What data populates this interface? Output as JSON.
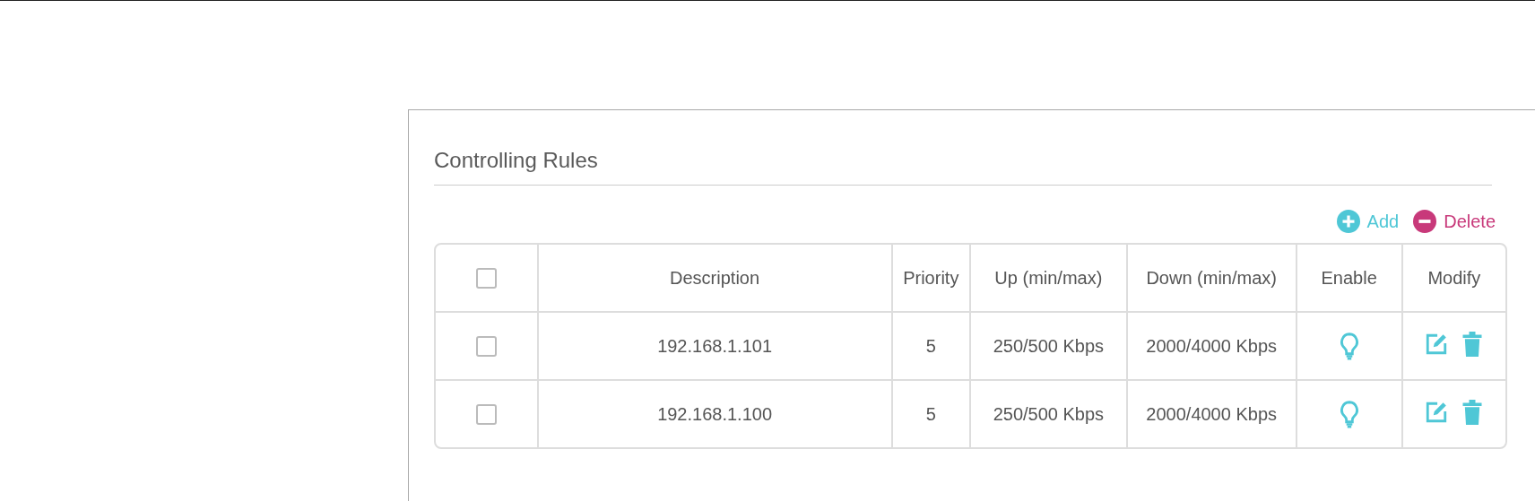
{
  "section": {
    "title": "Controlling Rules"
  },
  "actions": [
    {
      "kind": "add",
      "label": "Add"
    },
    {
      "kind": "delete",
      "label": "Delete"
    }
  ],
  "table": {
    "select_all": {
      "checked": false
    },
    "columns": [
      "Description",
      "Priority",
      "Up (min/max)",
      "Down (min/max)",
      "Enable",
      "Modify"
    ],
    "rows": [
      {
        "checked": false,
        "description": "192.168.1.101",
        "priority": "5",
        "up": "250/500 Kbps",
        "down": "2000/4000 Kbps",
        "enabled": true
      },
      {
        "checked": false,
        "description": "192.168.1.100",
        "priority": "5",
        "up": "250/500 Kbps",
        "down": "2000/4000 Kbps",
        "enabled": true
      }
    ]
  }
}
